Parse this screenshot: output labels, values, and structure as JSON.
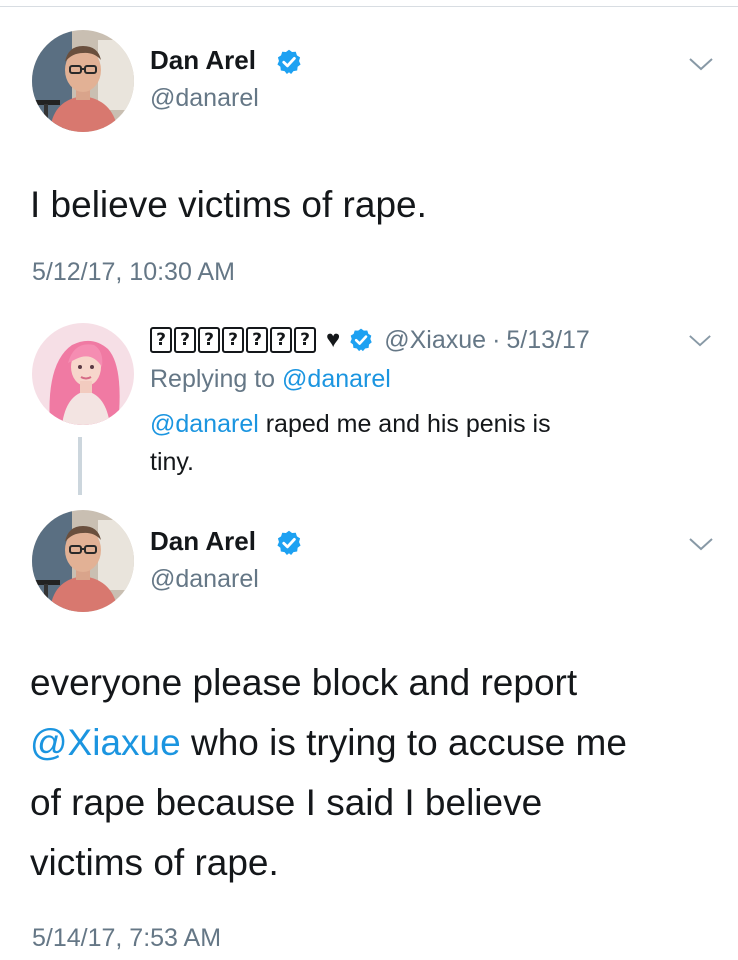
{
  "tweets": [
    {
      "author": {
        "name": "Dan Arel",
        "handle": "@danarel",
        "verified": true,
        "avatar_icon": "man-with-glasses-avatar"
      },
      "text": "I believe victims of rape.",
      "timestamp": "5/12/17, 10:30 AM"
    },
    {
      "author": {
        "name_glyphs": [
          "?",
          "?",
          "?",
          "?",
          "?",
          "?",
          "?"
        ],
        "name_suffix": "♥",
        "handle": "@Xiaxue",
        "verified": true,
        "avatar_icon": "pink-hair-woman-avatar"
      },
      "date": "5/13/17",
      "separator": "·",
      "replying_prefix": "Replying to",
      "replying_to": "@danarel",
      "mention": "@danarel",
      "text_line1": " raped me and his penis is",
      "text_line2": "tiny."
    },
    {
      "author": {
        "name": "Dan Arel",
        "handle": "@danarel",
        "verified": true,
        "avatar_icon": "man-with-glasses-avatar"
      },
      "lines": {
        "line1": "everyone please block and report",
        "line2_mention": "@Xiaxue",
        "line2_rest": " who is trying to accuse me",
        "line3": "of rape because I said I believe",
        "line4": "victims of rape."
      },
      "timestamp": "5/14/17, 7:53 AM"
    }
  ],
  "colors": {
    "link": "#1b95e0",
    "verified": "#1da1f2",
    "secondary_text": "#657786",
    "thread_line": "#ccd6dd"
  }
}
